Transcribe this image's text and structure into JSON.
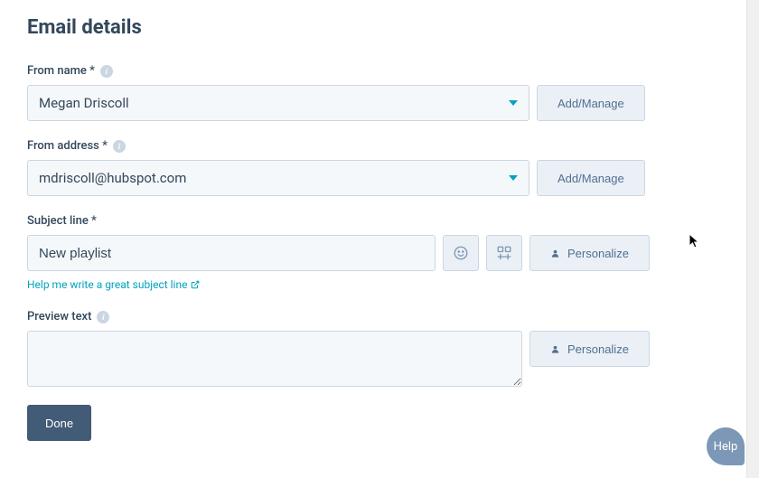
{
  "page": {
    "title": "Email details"
  },
  "fromName": {
    "label": "From name *",
    "value": "Megan Driscoll",
    "manageLabel": "Add/Manage"
  },
  "fromAddress": {
    "label": "From address *",
    "value": "mdriscoll@hubspot.com",
    "manageLabel": "Add/Manage"
  },
  "subject": {
    "label": "Subject line *",
    "value": "New playlist",
    "personalizeLabel": "Personalize",
    "helpText": "Help me write a great subject line"
  },
  "preview": {
    "label": "Preview text",
    "value": "",
    "personalizeLabel": "Personalize"
  },
  "buttons": {
    "done": "Done"
  },
  "help": {
    "label": "Help"
  }
}
